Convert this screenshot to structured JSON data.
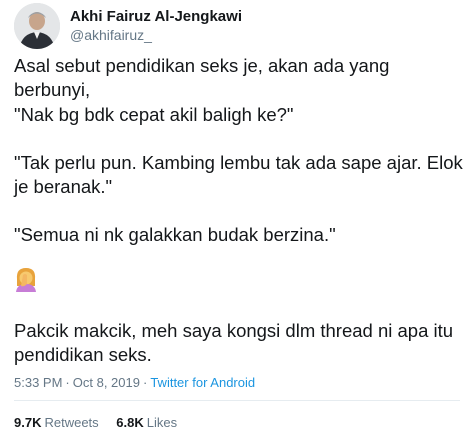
{
  "author": {
    "display_name": "Akhi Fairuz Al-Jengkawi",
    "handle": "@akhifairuz_"
  },
  "tweet": {
    "lines": [
      "Asal sebut pendidikan seks je, akan ada yang berbunyi,",
      "\"Nak bg bdk cepat akil baligh ke?\"",
      "\"Tak perlu pun. Kambing lembu tak ada sape ajar. Elok",
      "je beranak.\"",
      "\"Semua ni nk galakkan budak berzina.\"",
      "Pakcik makcik, meh saya kongsi dlm thread ni apa itu",
      "pendidikan seks."
    ],
    "emoji": "woman-facepalming-icon"
  },
  "meta": {
    "time": "5:33 PM",
    "separator": "·",
    "date": "Oct 8, 2019",
    "source": "Twitter for Android"
  },
  "stats": {
    "retweets_count": "9.7K",
    "retweets_label": "Retweets",
    "likes_count": "6.8K",
    "likes_label": "Likes"
  },
  "colors": {
    "text": "#14171a",
    "secondary": "#657786",
    "link": "#1b95e0",
    "divider": "#e6ecf0"
  }
}
